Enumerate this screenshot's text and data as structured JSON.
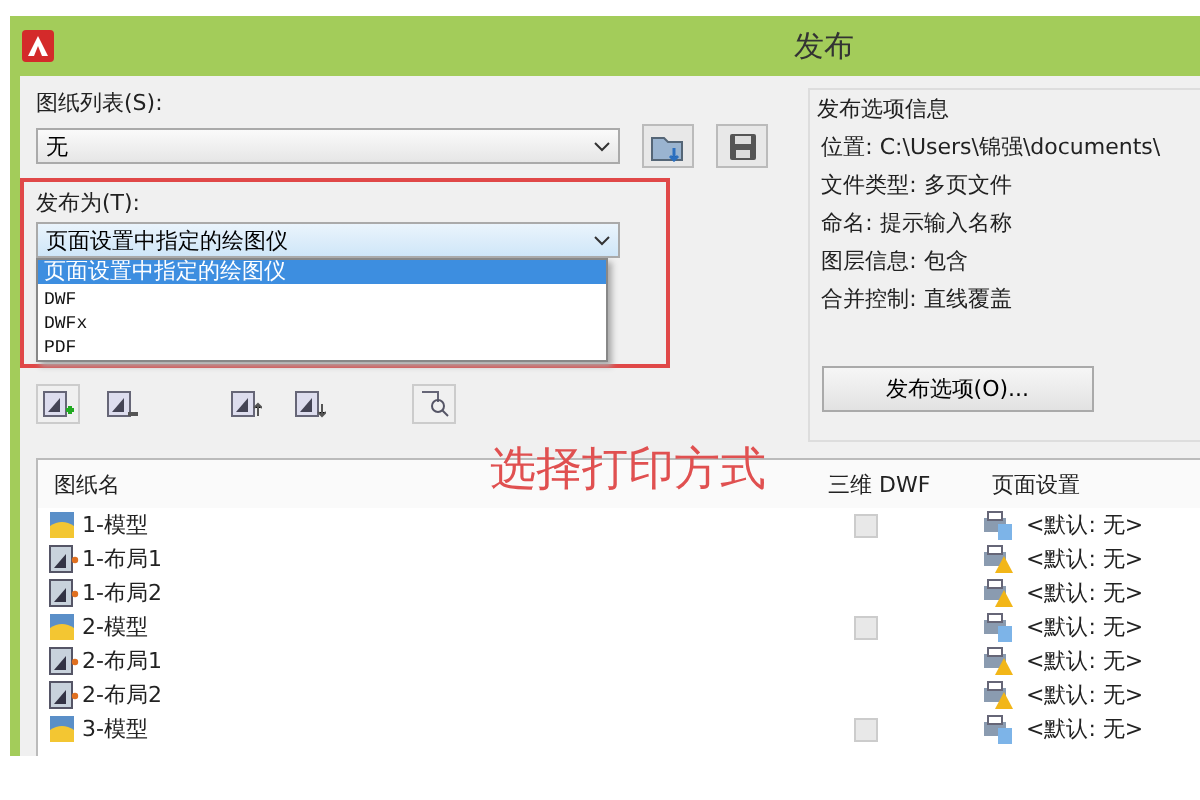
{
  "window": {
    "title": "发布"
  },
  "sheet_list": {
    "label": "图纸列表(S):",
    "value": "无"
  },
  "publish_as": {
    "label": "发布为(T):",
    "value": "页面设置中指定的绘图仪",
    "options": [
      {
        "label": "页面设置中指定的绘图仪",
        "selected": true
      },
      {
        "label": "DWF",
        "selected": false
      },
      {
        "label": "DWFx",
        "selected": false
      },
      {
        "label": "PDF",
        "selected": false
      }
    ]
  },
  "info": {
    "title": "发布选项信息",
    "lines": [
      "位置: C:\\Users\\锦强\\documents\\",
      "文件类型: 多页文件",
      "命名: 提示输入名称",
      "图层信息: 包含",
      "合并控制: 直线覆盖"
    ],
    "button": "发布选项(O)..."
  },
  "annotation": "选择打印方式",
  "table": {
    "columns": [
      "图纸名",
      "三维 DWF",
      "页面设置"
    ],
    "rows": [
      {
        "name": "1-模型",
        "kind": "model",
        "dwf3d": {
          "checked": false
        },
        "page_setup": "<默认: 无>"
      },
      {
        "name": "1-布局1",
        "kind": "layout",
        "page_setup": "<默认: 无>"
      },
      {
        "name": "1-布局2",
        "kind": "layout",
        "page_setup": "<默认: 无>"
      },
      {
        "name": "2-模型",
        "kind": "model",
        "dwf3d": {
          "checked": false
        },
        "page_setup": "<默认: 无>"
      },
      {
        "name": "2-布局1",
        "kind": "layout",
        "page_setup": "<默认: 无>"
      },
      {
        "name": "2-布局2",
        "kind": "layout",
        "page_setup": "<默认: 无>"
      },
      {
        "name": "3-模型",
        "kind": "model",
        "dwf3d": {
          "checked": false
        },
        "page_setup": "<默认: 无>"
      }
    ]
  }
}
